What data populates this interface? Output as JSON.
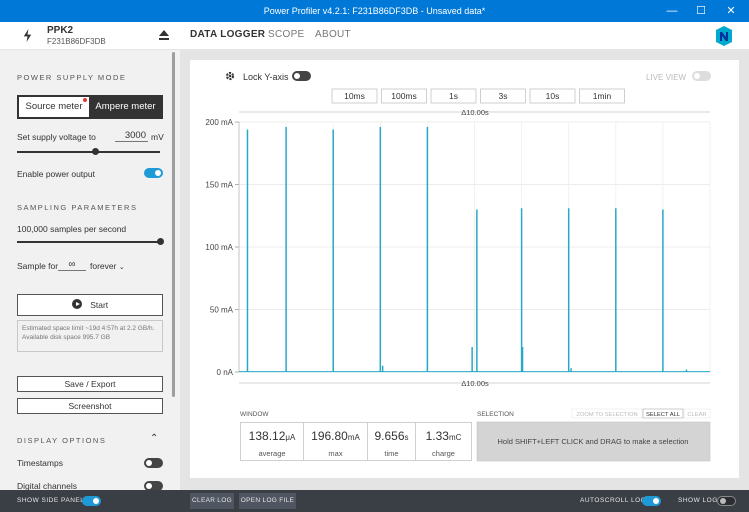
{
  "window": {
    "title": "Power Profiler v4.2.1: F231B86DF3DB - Unsaved data*",
    "minimize": "—",
    "maximize": "☐",
    "close": "✕"
  },
  "header": {
    "device_name": "PPK2",
    "device_serial": "F231B86DF3DB",
    "device_icon": "usb-device-icon",
    "eject_icon": "eject-icon",
    "tabs": [
      "DATA LOGGER",
      "SCOPE",
      "ABOUT"
    ],
    "active_tab": "DATA LOGGER",
    "logo_icon": "nordic-logo-icon"
  },
  "side_panel": {
    "power_supply_mode": {
      "title": "POWER SUPPLY MODE",
      "options": [
        "Source meter",
        "Ampere meter"
      ],
      "selected": "Source meter"
    },
    "supply_voltage": {
      "label": "Set supply voltage to",
      "value": "3000",
      "unit": "mV",
      "slider_fraction": 0.55
    },
    "enable_power_output": {
      "label": "Enable power output",
      "on": true
    },
    "sampling": {
      "title": "SAMPLING PARAMETERS",
      "rate_label": "100,000 samples per second",
      "rate_fraction": 1.0,
      "sample_for_label": "Sample for",
      "sample_for_value": "∞",
      "sample_for_unit": "forever"
    },
    "start_button": "Start",
    "space_note": "Estimated space limit ~19d 4:57h at 2.2 GB/h. Available disk space 995.7 GB",
    "save_export": "Save / Export",
    "screenshot": "Screenshot",
    "display_options": {
      "title": "DISPLAY OPTIONS",
      "timestamps": {
        "label": "Timestamps",
        "on": false
      },
      "digital_channels": {
        "label": "Digital channels",
        "on": false
      }
    }
  },
  "chart_controls": {
    "settings_icon": "gear-icon",
    "lock_y_axis": {
      "label": "Lock Y-axis",
      "on": false
    },
    "live_view": {
      "label": "LIVE VIEW",
      "on": false
    },
    "window_buttons": [
      "10ms",
      "100ms",
      "1s",
      "3s",
      "10s",
      "1min"
    ],
    "span_top": "Δ10.00s",
    "span_bottom": "Δ10.00s"
  },
  "chart_data": {
    "type": "line",
    "title": "",
    "xlabel": "",
    "ylabel": "",
    "ylim": [
      0,
      200
    ],
    "xlim": [
      0,
      10
    ],
    "ytick_labels": [
      "200 mA",
      "150 mA",
      "100 mA",
      "50 mA",
      "0 nA"
    ],
    "ytick_values": [
      200,
      150,
      100,
      50,
      0
    ],
    "grid": true,
    "color": "#26a9c7",
    "series": [
      {
        "baseline": 0.3,
        "spikes": [
          {
            "x": 0.18,
            "y": 194
          },
          {
            "x": 1.0,
            "y": 196
          },
          {
            "x": 2.0,
            "y": 194
          },
          {
            "x": 3.0,
            "y": 196
          },
          {
            "x": 3.05,
            "y": 5
          },
          {
            "x": 4.0,
            "y": 196
          },
          {
            "x": 4.95,
            "y": 20
          },
          {
            "x": 5.05,
            "y": 130
          },
          {
            "x": 6.0,
            "y": 131
          },
          {
            "x": 6.02,
            "y": 20
          },
          {
            "x": 7.0,
            "y": 131
          },
          {
            "x": 7.05,
            "y": 3
          },
          {
            "x": 8.0,
            "y": 131
          },
          {
            "x": 9.0,
            "y": 130
          },
          {
            "x": 9.5,
            "y": 2
          }
        ]
      }
    ]
  },
  "window_stats": {
    "title": "WINDOW",
    "average": {
      "value": "138.12",
      "unit": "μA",
      "label": "average"
    },
    "max": {
      "value": "196.80",
      "unit": "mA",
      "label": "max"
    },
    "time": {
      "value": "9.656",
      "unit": "s",
      "label": "time"
    },
    "charge": {
      "value": "1.33",
      "unit": "mC",
      "label": "charge"
    }
  },
  "selection": {
    "title": "SELECTION",
    "zoom_to_selection": "ZOOM TO SELECTION",
    "select_all": "SELECT ALL",
    "clear": "CLEAR",
    "hint": "Hold SHIFT+LEFT CLICK and DRAG to make a selection"
  },
  "bottom_bar": {
    "show_side_panel": {
      "label": "SHOW SIDE PANEL",
      "on": true
    },
    "clear_log": "CLEAR LOG",
    "open_log_file": "OPEN LOG FILE",
    "autoscroll_log": {
      "label": "AUTOSCROLL LOG",
      "on": true
    },
    "show_log": {
      "label": "SHOW LOG",
      "on": false
    }
  }
}
